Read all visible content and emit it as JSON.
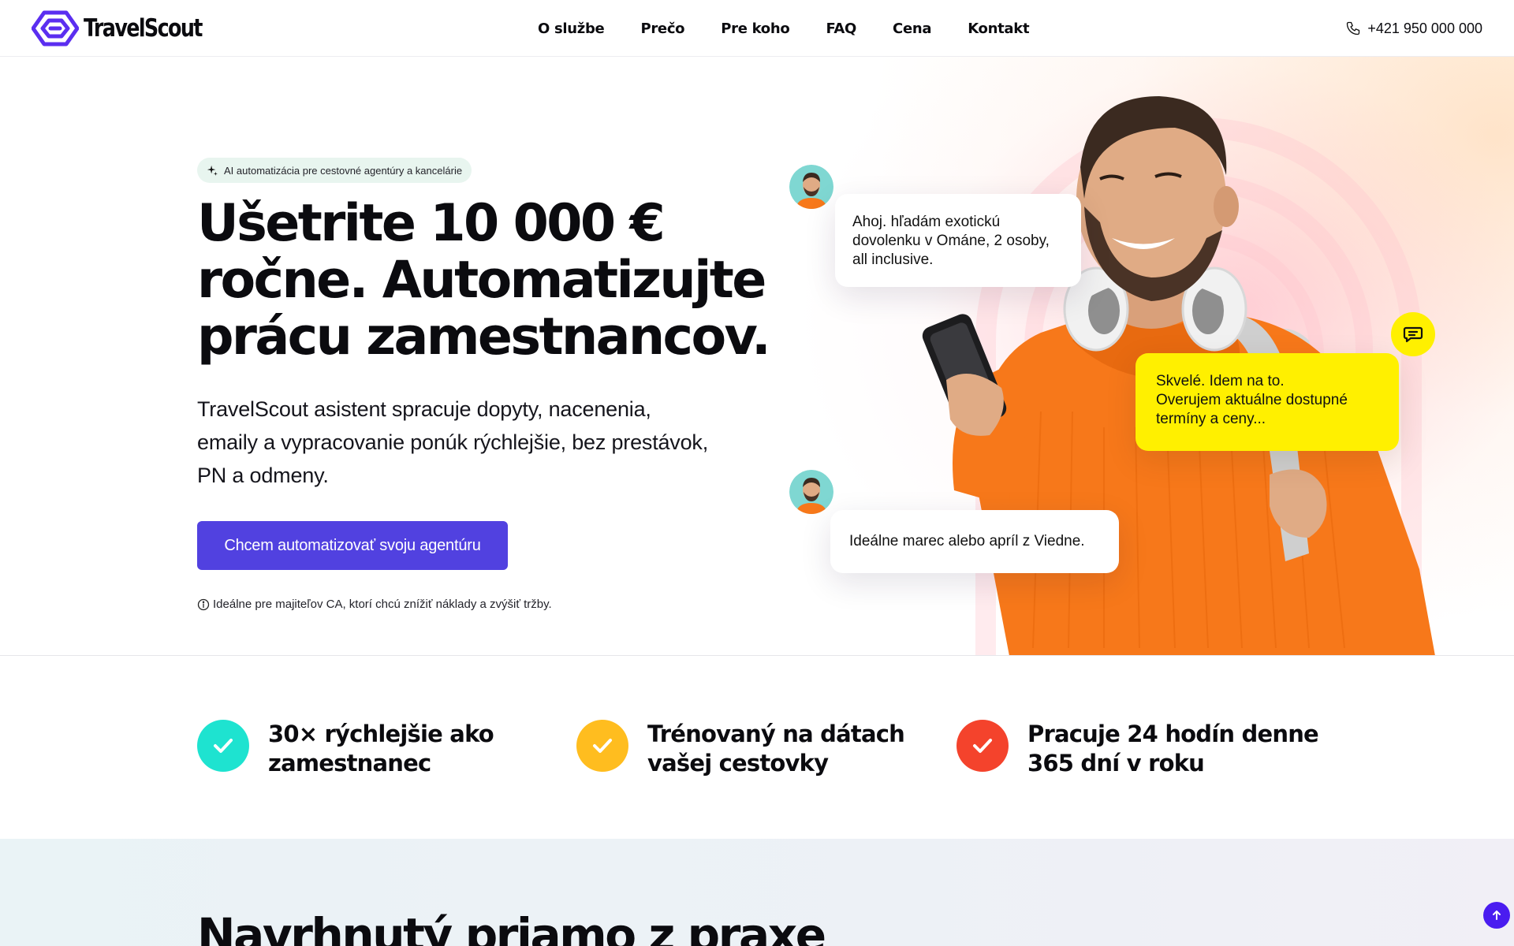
{
  "brand": {
    "name": "TravelScout",
    "accent": "#5141e0",
    "logo_color": "#5b2ef0"
  },
  "nav": {
    "links": [
      "O službe",
      "Prečo",
      "Pre koho",
      "FAQ",
      "Cena",
      "Kontakt"
    ],
    "phone": "+421 950 000 000",
    "phone_icon": "phone-icon"
  },
  "hero": {
    "badge": "AI automatizácia pre cestovné agentúry a kancelárie",
    "title_lines": [
      "Ušetrite 10 000 €",
      "ročne. Automatizujte",
      "prácu zamestnancov."
    ],
    "subtitle_lines": [
      "TravelScout asistent spracuje dopyty, nacenenia,",
      "emaily a vypracovanie ponúk rýchlejšie, bez prestávok,",
      "PN a odmeny."
    ],
    "cta": "Chcem automatizovať svoju agentúru",
    "note": "Ideálne pre majiteľov CA, ktorí chcú znížiť náklady a zvýšiť tržby."
  },
  "chat": {
    "bubble_1_lines": [
      "Ahoj. hľadám exotickú",
      "dovolenku v Ománe, 2 osoby,",
      "all inclusive."
    ],
    "bubble_2_lines": [
      "Skvelé. Idem na to.",
      "Overujem aktuálne dostupné",
      "termíny a ceny..."
    ],
    "bubble_3": "Ideálne marec alebo apríl z Viedne.",
    "bubble_2_color": "#fff000"
  },
  "features": [
    {
      "lines": [
        "30× rýchlejšie ako",
        "zamestnanec"
      ],
      "color": "#1ee3d0",
      "icon": "check-icon"
    },
    {
      "lines": [
        "Trénovaný na dátach",
        "vašej cestovky"
      ],
      "color": "#ffbd1f",
      "icon": "check-icon"
    },
    {
      "lines": [
        "Pracuje 24 hodín denne",
        "365 dní v roku"
      ],
      "color": "#f4432c",
      "icon": "check-icon"
    }
  ],
  "section_two": {
    "title": "Navrhnutý priamo z praxe"
  }
}
